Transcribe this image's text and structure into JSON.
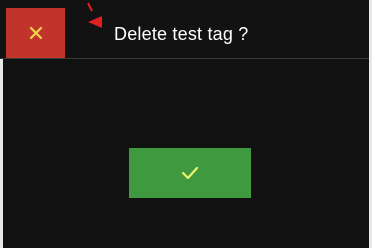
{
  "dialog": {
    "title": "Delete test tag ?"
  },
  "buttons": {
    "close": {
      "icon": "close-x-icon",
      "color": "#c0342c",
      "icon_color": "#f2d24a"
    },
    "confirm": {
      "icon": "checkmark-icon",
      "color": "#3f9a3f",
      "icon_color": "#e9f56a"
    }
  },
  "annotation": {
    "pointer_color": "#e02020"
  }
}
